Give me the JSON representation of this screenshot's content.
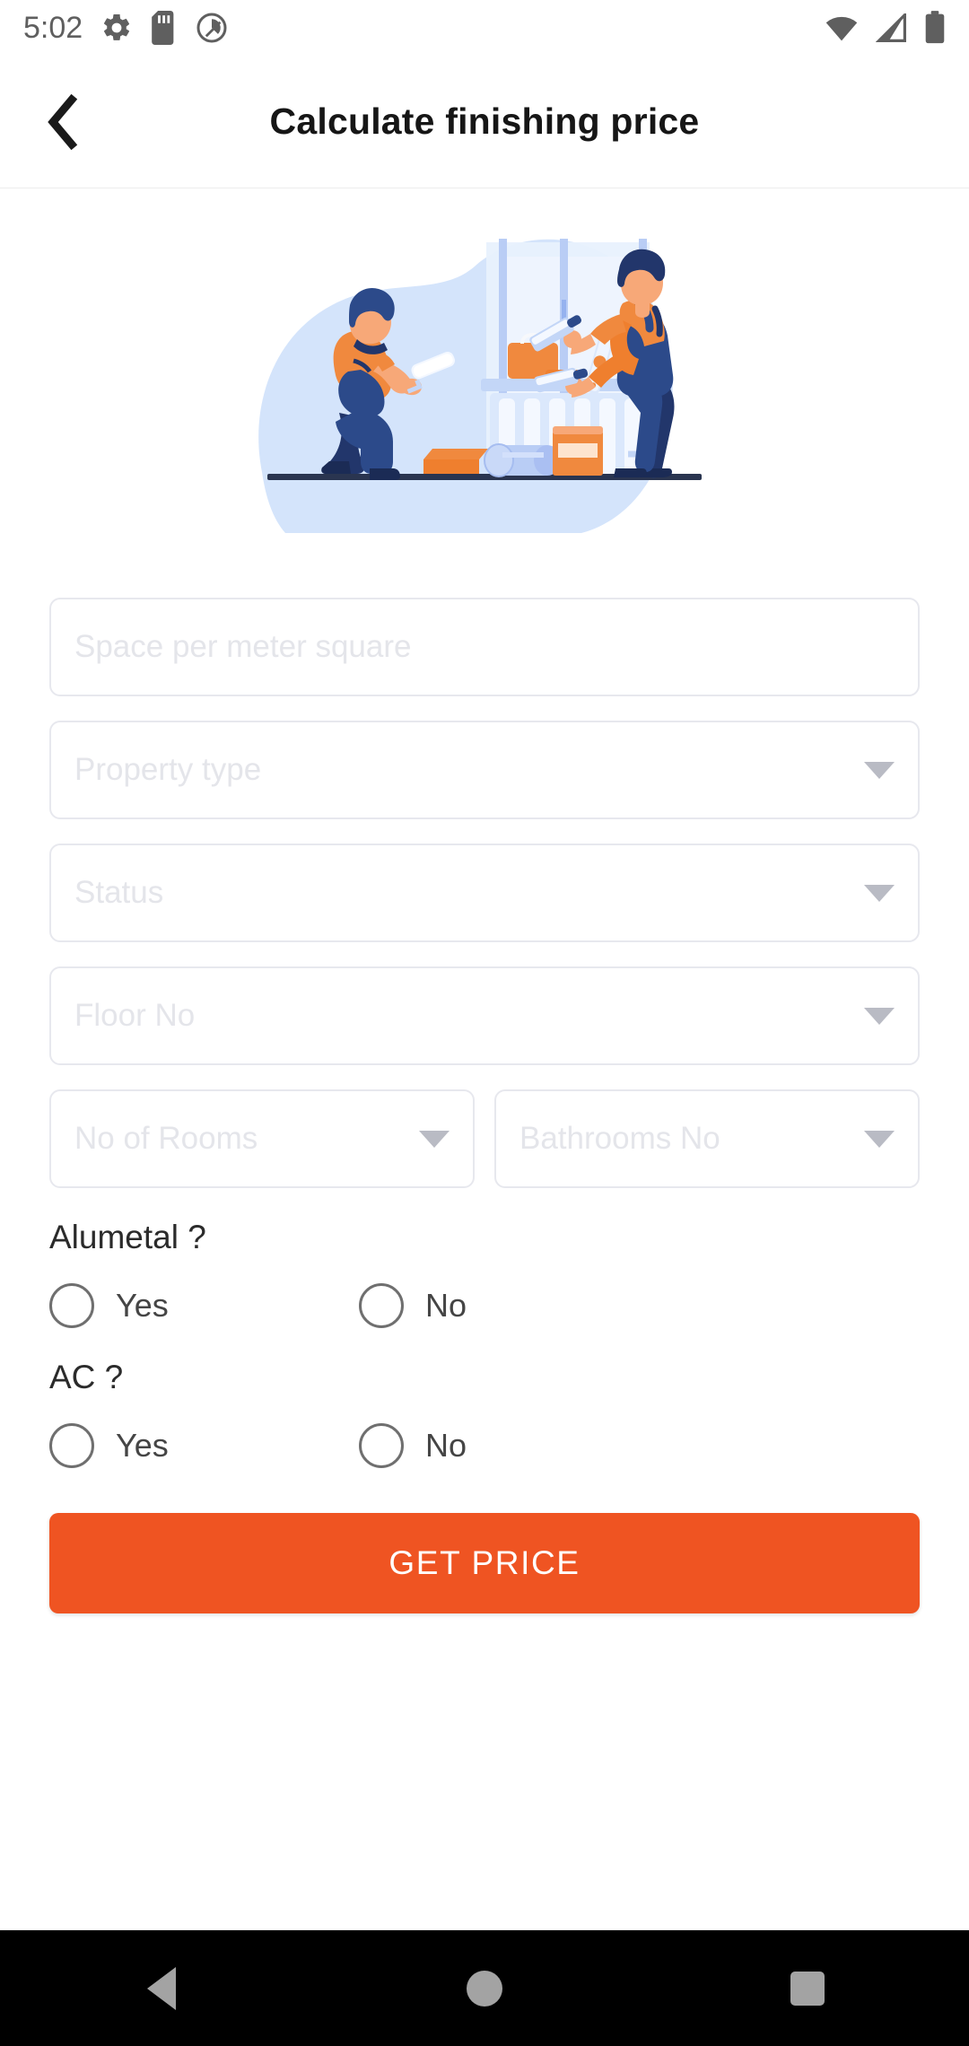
{
  "status_bar": {
    "time": "5:02",
    "left_icons": [
      "gear-icon",
      "sd-card-icon",
      "data-saver-icon"
    ],
    "right_icons": [
      "wifi-icon",
      "signal-icon",
      "battery-icon"
    ],
    "icon_color": "#5f5f5f"
  },
  "app_bar": {
    "back_label": "back-arrow",
    "title": "Calculate finishing price"
  },
  "illustration": {
    "name": "home-renovation-workers-illustration",
    "colors": {
      "blob": "#d4e4fb",
      "wall": "#e8f1fd",
      "orange": "#f0893e",
      "orange_dark": "#ef7f2e",
      "navy": "#2c4a8a",
      "navy_dark": "#22366b",
      "skin": "#f7a878",
      "light_blue": "#b9cdf5",
      "white": "#ffffff",
      "floor": "#2a3550"
    }
  },
  "form": {
    "fields": [
      {
        "name": "space-per-meter-square",
        "placeholder": "Space per meter square",
        "value": "",
        "type": "text",
        "caret": false
      },
      {
        "name": "property-type",
        "placeholder": "Property type",
        "value": "",
        "type": "dropdown",
        "caret": true
      },
      {
        "name": "status",
        "placeholder": "Status",
        "value": "",
        "type": "dropdown",
        "caret": true
      },
      {
        "name": "floor-no",
        "placeholder": "Floor No",
        "value": "",
        "type": "dropdown",
        "caret": true
      }
    ],
    "paired_fields": [
      {
        "name": "no-of-rooms",
        "placeholder": "No of Rooms",
        "value": "",
        "type": "dropdown",
        "caret": true
      },
      {
        "name": "bathrooms-no",
        "placeholder": "Bathrooms No",
        "value": "",
        "type": "dropdown",
        "caret": true
      }
    ],
    "questions": [
      {
        "name": "alumetal",
        "label": "Alumetal ?",
        "options": [
          {
            "label": "Yes",
            "selected": false
          },
          {
            "label": "No",
            "selected": false
          }
        ]
      },
      {
        "name": "ac",
        "label": "AC ?",
        "options": [
          {
            "label": "Yes",
            "selected": false
          },
          {
            "label": "No",
            "selected": false
          }
        ]
      }
    ],
    "submit": {
      "label": "GET PRICE",
      "color": "#ef5422"
    }
  },
  "nav_bar": {
    "items": [
      {
        "name": "nav-back-button",
        "icon": "triangle-back-icon"
      },
      {
        "name": "nav-home-button",
        "icon": "circle-home-icon"
      },
      {
        "name": "nav-recents-button",
        "icon": "square-recents-icon"
      }
    ],
    "background": "#000000"
  }
}
